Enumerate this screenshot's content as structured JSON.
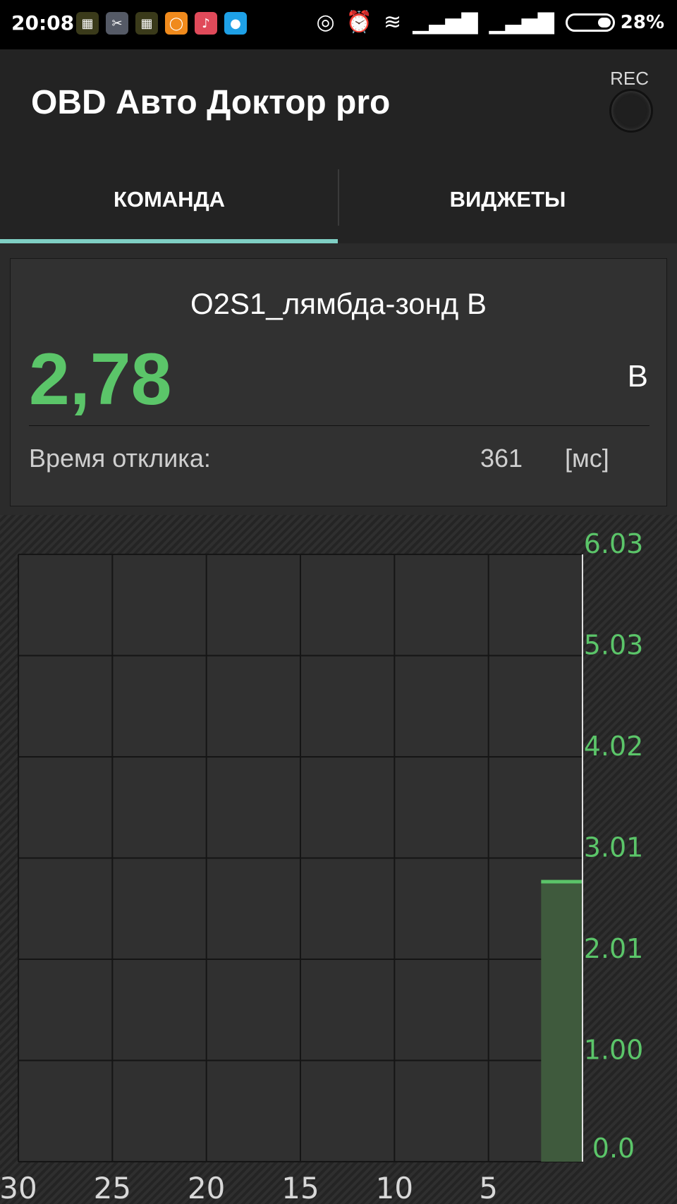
{
  "status_bar": {
    "time": "20:08",
    "battery_percent": "28%",
    "notification_icons": [
      "app-icon",
      "app-icon",
      "app-icon",
      "chat-icon",
      "music-icon",
      "drop-icon"
    ],
    "system_icons": [
      "hotspot-icon",
      "alarm-icon",
      "wifi-icon",
      "signal-icon",
      "signal-icon",
      "battery-icon"
    ]
  },
  "app_bar": {
    "title": "OBD Авто Доктор pro",
    "rec_label": "REC"
  },
  "tabs": [
    {
      "label": "КОМАНДА",
      "active": true
    },
    {
      "label": "ВИДЖЕТЫ",
      "active": false
    }
  ],
  "colors": {
    "accent_tab": "#7fcfc4",
    "value_green": "#5bc569",
    "bar_fill": "#3f5a3d"
  },
  "sensor": {
    "name": "O2S1_лямбда-зонд В",
    "value": "2,78",
    "unit": "В",
    "response_label": "Время отклика:",
    "response_value": "361",
    "response_unit": "[мс]"
  },
  "chart_data": {
    "type": "bar",
    "x_ticks": [
      "30",
      "25",
      "20",
      "15",
      "10",
      "5"
    ],
    "y_ticks": [
      "6.03",
      "5.03",
      "4.02",
      "3.01",
      "2.01",
      "1.00",
      "0.0"
    ],
    "ylim": [
      0,
      6.03
    ],
    "xlim": [
      30,
      0
    ],
    "grid": true,
    "series": [
      {
        "values": [
          2.78
        ],
        "x": [
          0
        ]
      }
    ]
  }
}
